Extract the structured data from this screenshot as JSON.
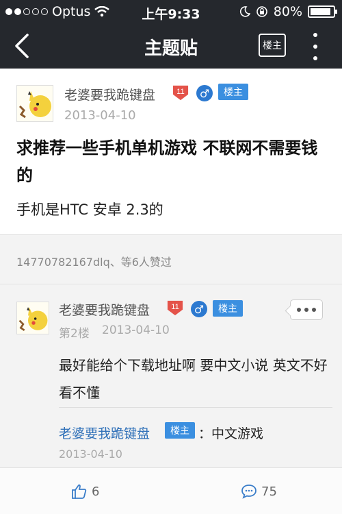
{
  "status_bar": {
    "carrier": "Optus",
    "time": "上午9:33",
    "battery": "80%"
  },
  "nav": {
    "title": "主题贴",
    "louzhu_button": "楼主"
  },
  "post": {
    "author": "老婆要我跪键盘",
    "level": "11",
    "gender_symbol": "♂",
    "badge": "楼主",
    "date": "2013-04-10",
    "title": "求推荐一些手机单机游戏 不联网不需要钱的",
    "body": "手机是HTC 安卓 2.3的",
    "likes_text": "14770782167dlq、等6人赞过"
  },
  "reply": {
    "author": "老婆要我跪键盘",
    "level": "11",
    "gender_symbol": "♂",
    "badge": "楼主",
    "floor": "第2楼",
    "date": "2013-04-10",
    "text": "最好能给个下载地址啊 要中文小说 英文不好看不懂",
    "sub_reply": {
      "author": "老婆要我跪键盘",
      "badge": "楼主",
      "text": "：中文游戏",
      "date": "2013-04-10"
    }
  },
  "bottom_bar": {
    "like_count": "6",
    "comment_count": "75"
  },
  "colors": {
    "nav_bg": "#25282d",
    "badge_blue": "#3b8fe0",
    "level_red": "#e4534a",
    "link_blue": "#2f70b8"
  }
}
